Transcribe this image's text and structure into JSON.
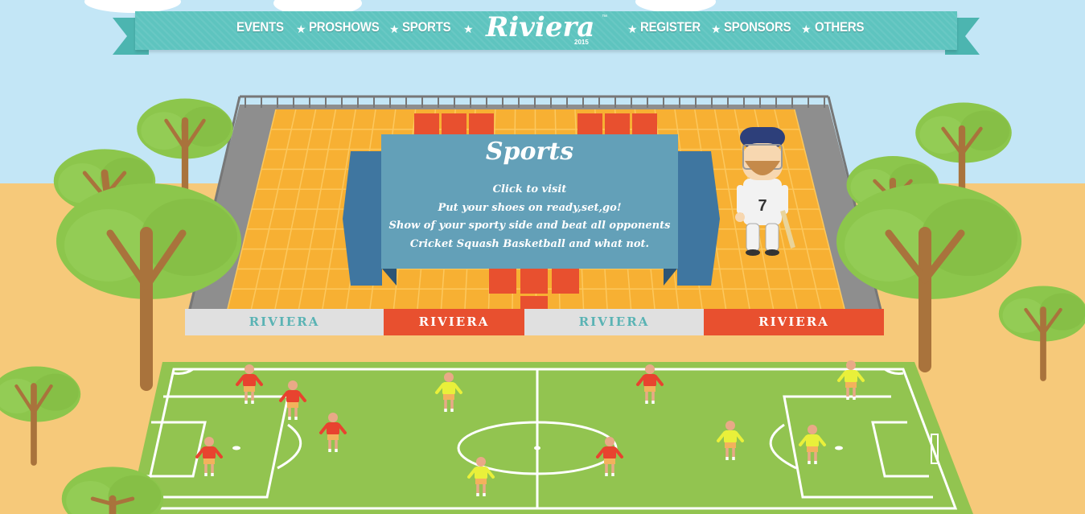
{
  "nav": {
    "items": [
      {
        "label": "EVENTS"
      },
      {
        "label": "PROSHOWS"
      },
      {
        "label": "SPORTS"
      },
      {
        "label": "REGISTER"
      },
      {
        "label": "SPONSORS"
      },
      {
        "label": "OTHERS"
      }
    ],
    "logo": {
      "text": "Riviera",
      "year": "2015",
      "tm": "™"
    }
  },
  "panel": {
    "title": "Sports",
    "lines": [
      "Click to visit",
      "Put your shoes on ready,set,go!",
      "Show of your sporty side and beat all opponents",
      "Cricket Squash Basketball and what not."
    ]
  },
  "banner": {
    "labels": [
      "RIVIERA",
      "RIVIERA",
      "RIVIERA",
      "RIVIERA"
    ]
  },
  "player": {
    "jersey_number": "7"
  },
  "colors": {
    "sky": "#c3e6f6",
    "sand": "#f6c97a",
    "nav": "#5ec4bf",
    "panel": "#63a0b8",
    "panel_side": "#3f76a0",
    "seat_orange": "#f7b033",
    "seat_red": "#e8502f",
    "grass": "#92c450",
    "tree_green": "#8cc64c",
    "trunk": "#a9733c",
    "team_red": "#e8432f",
    "team_yellow": "#e9f03a"
  }
}
